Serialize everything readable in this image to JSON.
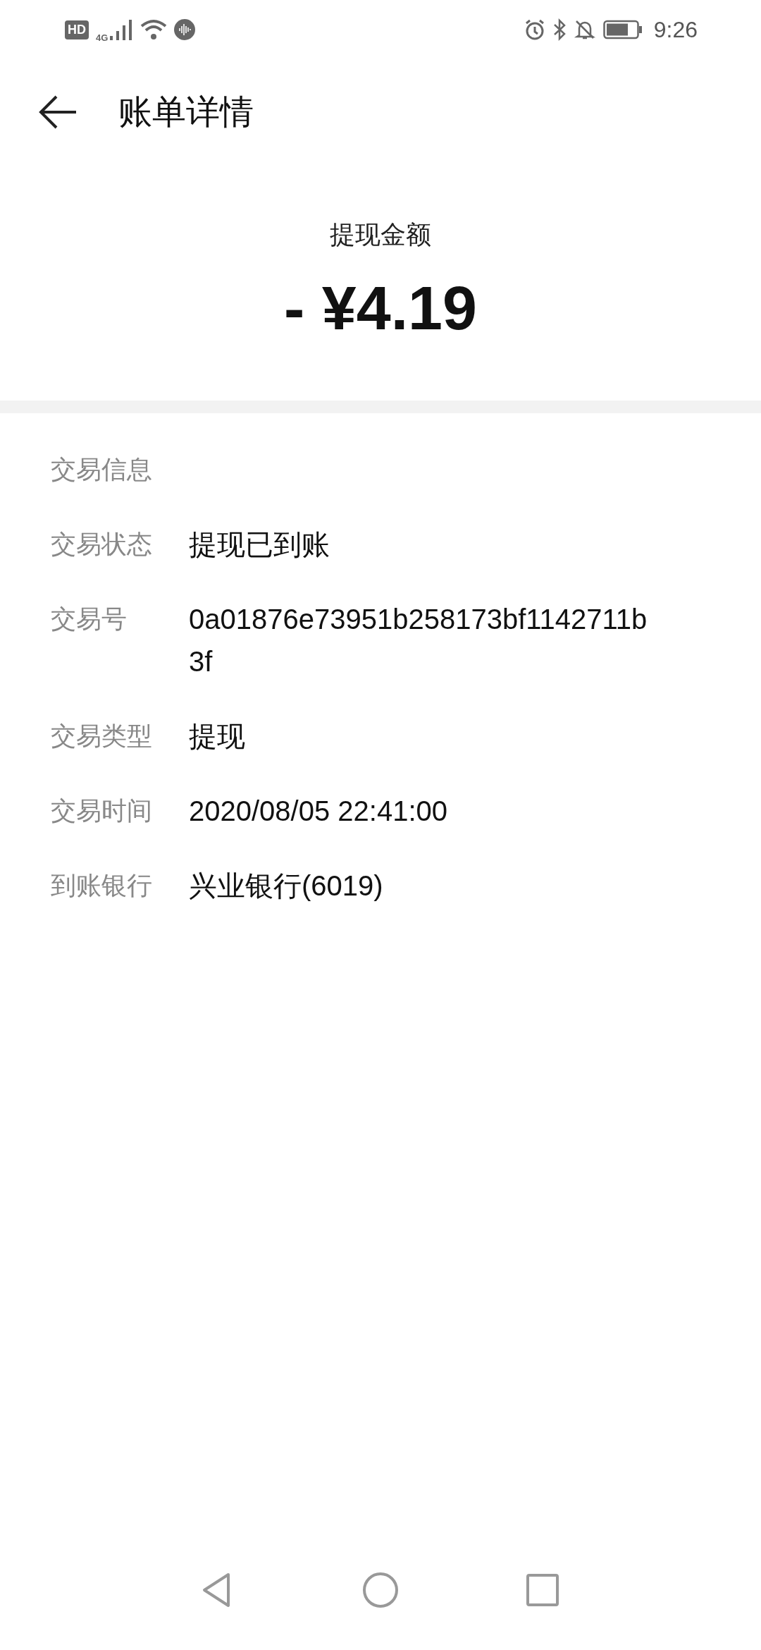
{
  "status_bar": {
    "hd_badge": "HD",
    "network": "4G",
    "time": "9:26"
  },
  "header": {
    "title": "账单详情"
  },
  "summary": {
    "label": "提现金额",
    "amount": "- ¥4.19"
  },
  "details": {
    "heading": "交易信息",
    "rows": [
      {
        "label": "交易状态",
        "value": "提现已到账"
      },
      {
        "label": "交易号",
        "value": "0a01876e73951b258173bf1142711b3f"
      },
      {
        "label": "交易类型",
        "value": "提现"
      },
      {
        "label": "交易时间",
        "value": "2020/08/05 22:41:00"
      },
      {
        "label": "到账银行",
        "value": "兴业银行(6019)"
      }
    ]
  }
}
